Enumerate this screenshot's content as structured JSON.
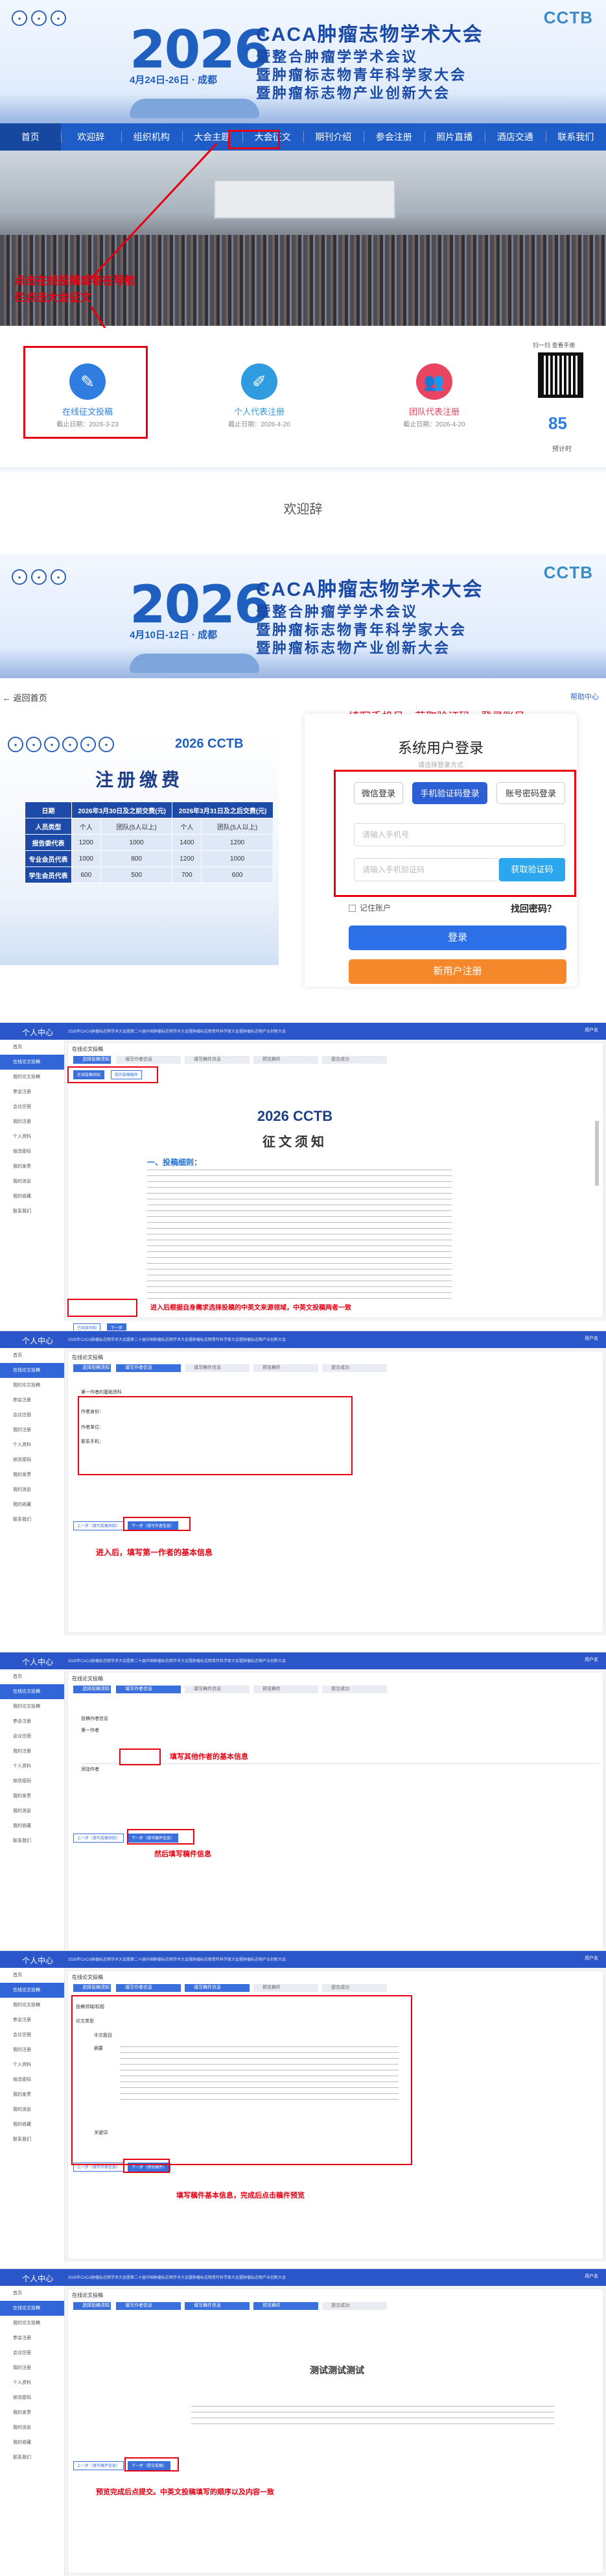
{
  "section1": {
    "banner": {
      "year": "2026",
      "dates": "4月24日-26日 · 成都",
      "title": "CACA肿瘤志物学术大会",
      "sub1": "暨整合肿瘤学学术会议",
      "sub2": "暨肿瘤标志物青年科学家大会",
      "sub3": "暨肿瘤标志物产业创新大会",
      "brand": "CCTB"
    },
    "nav": [
      "首页",
      "欢迎辞",
      "组织机构",
      "大会主题",
      "大会征文",
      "期刊介绍",
      "参会注册",
      "照片直播",
      "酒店交通",
      "联系我们"
    ],
    "callout": "点击在线投稿或者在导航栏点击大会征文",
    "entries": [
      {
        "title": "在线征文投稿",
        "date": "截止日期：2026-3-23"
      },
      {
        "title": "个人代表注册",
        "date": "截止日期：2026-4-20"
      },
      {
        "title": "团队代表注册",
        "date": "截止日期：2026-4-20"
      }
    ],
    "qr": {
      "caption": "扫一扫 查看手册",
      "count": "85",
      "count_label": "预计时"
    },
    "welcome": "欢迎辞"
  },
  "section2": {
    "banner": {
      "year": "2026",
      "dates": "4月10日-12日 · 成都",
      "title": "CACA肿瘤志物学术大会",
      "sub1": "暨整合肿瘤学学术会议",
      "sub2": "暨肿瘤标志物青年科学家大会",
      "sub3": "暨肿瘤标志物产业创新大会",
      "brand": "CCTB"
    },
    "back": "返回首页",
    "help": "帮助中心",
    "annotation": "填写手机号，获取验证码，登录账号",
    "login": {
      "title": "系统用户登录",
      "subtitle": "请选择登录方式",
      "tabs": [
        "微信登录",
        "手机验证码登录",
        "账号密码登录"
      ],
      "phone_placeholder": "请输入手机号",
      "code_placeholder": "请输入手机验证码",
      "get_code": "获取验证码",
      "remember": "记住账户",
      "forgot": "找回密码？",
      "login_btn": "登录",
      "register_btn": "新用户注册"
    },
    "fee": {
      "title": "注册缴费",
      "brand": "2026 CCTB",
      "head": [
        "日期",
        "2026年3月30日及之前交费(元)",
        "2026年3月31日及之后交费(元)"
      ],
      "sub": [
        "人员类型",
        "个人",
        "团队(5人以上)",
        "个人",
        "团队(5人以上)"
      ],
      "rows": [
        [
          "报告委代表",
          "1200",
          "1000",
          "1400",
          "1200"
        ],
        [
          "专业会员代表",
          "1000",
          "800",
          "1200",
          "1000"
        ],
        [
          "学生会员代表",
          "600",
          "500",
          "700",
          "600"
        ]
      ]
    }
  },
  "admin": {
    "title": "个人中心",
    "header_text": "2026年CACA肿瘤标志物学术大会暨第二十届中国肿瘤标志物学术大会暨肿瘤标志物青年科学家大会暨肿瘤标志物产业创新大会",
    "user": "用户名",
    "badge": "★ 会议管理员",
    "sidebar": [
      "首页",
      "在线论文投稿",
      "我的论文投稿",
      "参会注册",
      "会议住宿",
      "我的注册",
      "个人资料",
      "修改密码",
      "我的发票",
      "我的消息",
      "我的收藏",
      "联系我们"
    ],
    "screen1": {
      "page": "在线论文投稿",
      "steps": [
        "选择投稿须知",
        "填写作者信息",
        "填写稿件信息",
        "预览稿件",
        "提交成功"
      ],
      "subtabs": [
        "在线投稿须知",
        "我的投稿稿件"
      ],
      "notice_title": "征文须知",
      "notice_sections": [
        "一、投稿细则："
      ],
      "read_label": "已阅读须知",
      "next": "下一步",
      "note": "进入后根据自身需求选择投稿的中英文来源领域，中英文投稿两者一致"
    },
    "screen2": {
      "page": "在线论文投稿",
      "q1": "第一作者的基础资料",
      "q2": "作者身份：",
      "q3": "作者单位：",
      "q4": "联系手机：",
      "prev": "上一步（填写投稿须知）",
      "next": "下一步（填写作者信息）",
      "note": "进入后，填写第一作者的基本信息"
    },
    "screen3": {
      "page": "在线论文投稿",
      "q1": "投稿作者信息",
      "q2": "第一作者",
      "add": "添加作者",
      "prev": "上一步（填写投稿须知）",
      "next": "下一步（填写稿件信息）",
      "note1": "填写其他作者的基本信息",
      "note2": "然后填写稿件信息"
    },
    "screen4": {
      "page": "在线论文投稿",
      "field1": "投稿领域/标题",
      "field2": "论文类型",
      "field3": "中文题目",
      "field4": "摘要",
      "field5": "关键词",
      "prev": "上一步（填写作者信息）",
      "next": "下一步（预览稿件）",
      "note": "填写稿件基本信息，完成后点击稿件预览"
    },
    "screen5": {
      "page": "在线论文投稿",
      "title": "测试测试测试",
      "prev": "上一步（填写稿件信息）",
      "submit": "下一步（提交投稿）",
      "note": "预览完成后点提交。中英文投稿填写的顺序以及内容一致"
    }
  },
  "colors": {
    "primary": "#1e5cc7",
    "accent": "#e60012",
    "orange": "#f5882a"
  }
}
